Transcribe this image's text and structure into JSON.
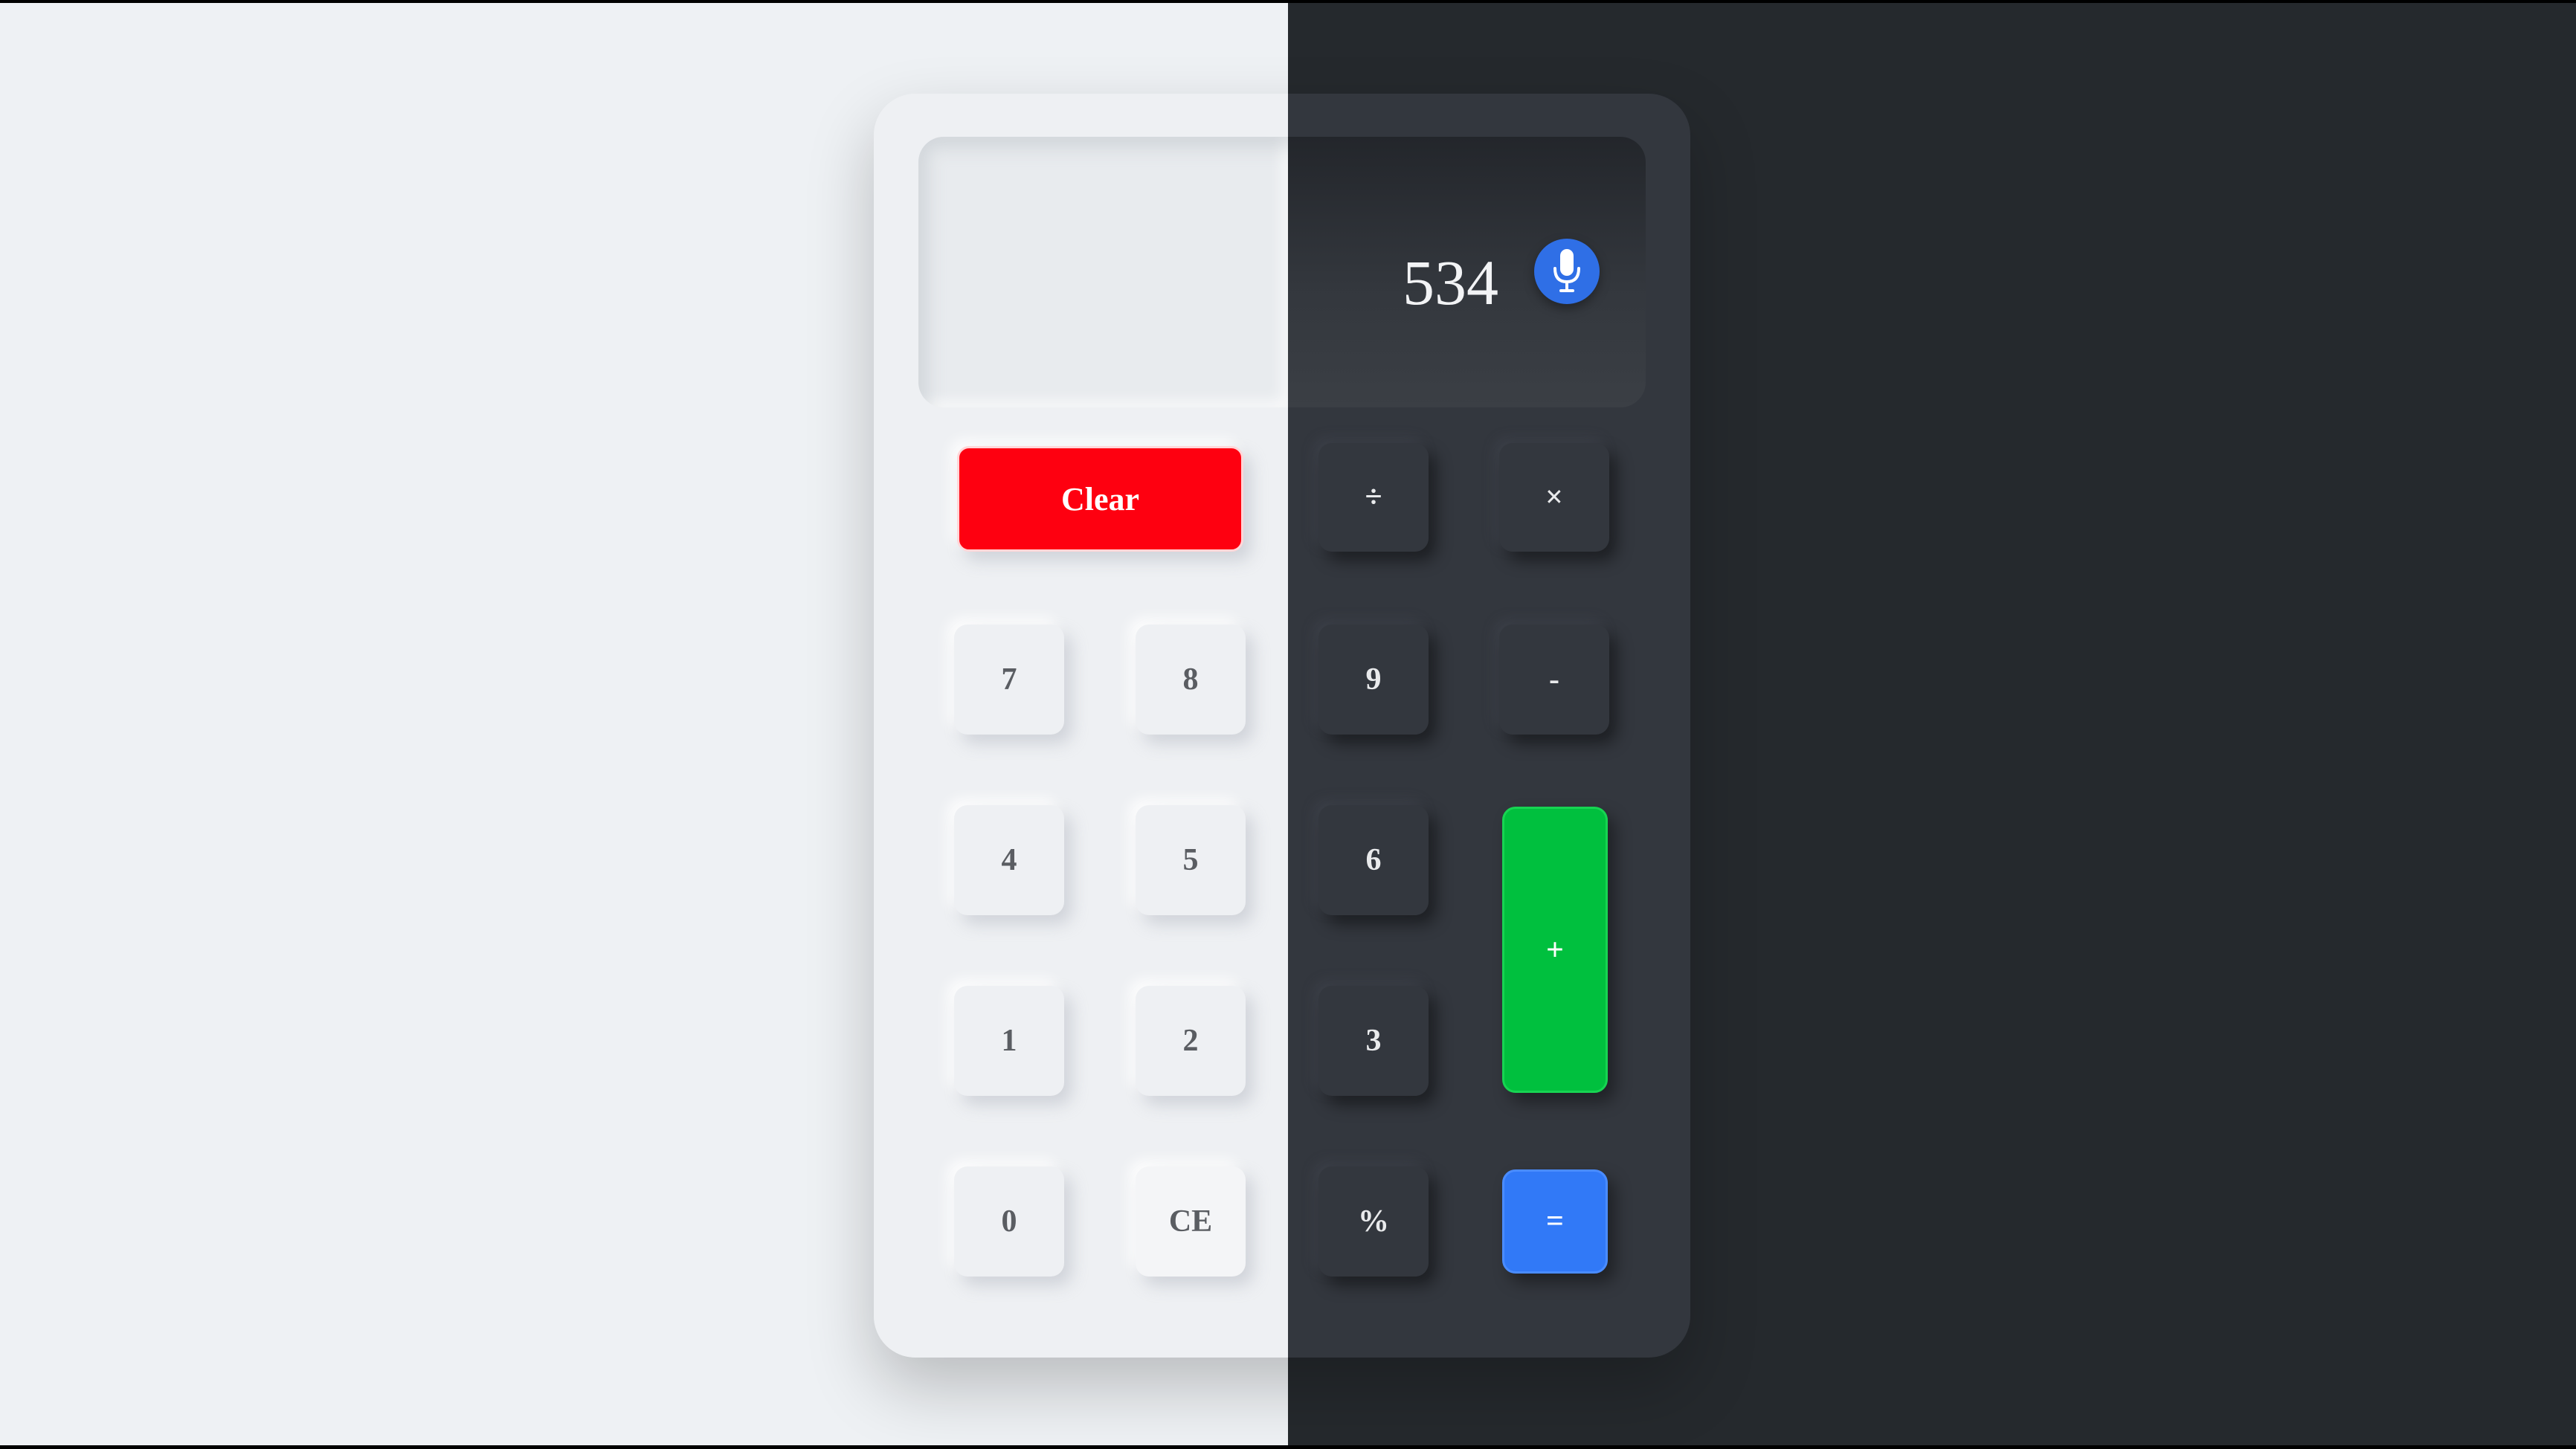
{
  "display": {
    "value": "534",
    "mic_icon": "microphone-icon"
  },
  "buttons": {
    "clear": "Clear",
    "divide": "÷",
    "multiply": "×",
    "seven": "7",
    "eight": "8",
    "nine": "9",
    "minus": "-",
    "four": "4",
    "five": "5",
    "six": "6",
    "plus": "+",
    "one": "1",
    "two": "2",
    "three": "3",
    "zero": "0",
    "clear_entry": "CE",
    "percent": "%",
    "equals": "="
  },
  "colors": {
    "light_bg": "#eef1f4",
    "dark_bg": "#25292d",
    "clear": "#fe0010",
    "plus": "#00c03e",
    "equals": "#3179f7",
    "mic": "#2f6fe6"
  }
}
